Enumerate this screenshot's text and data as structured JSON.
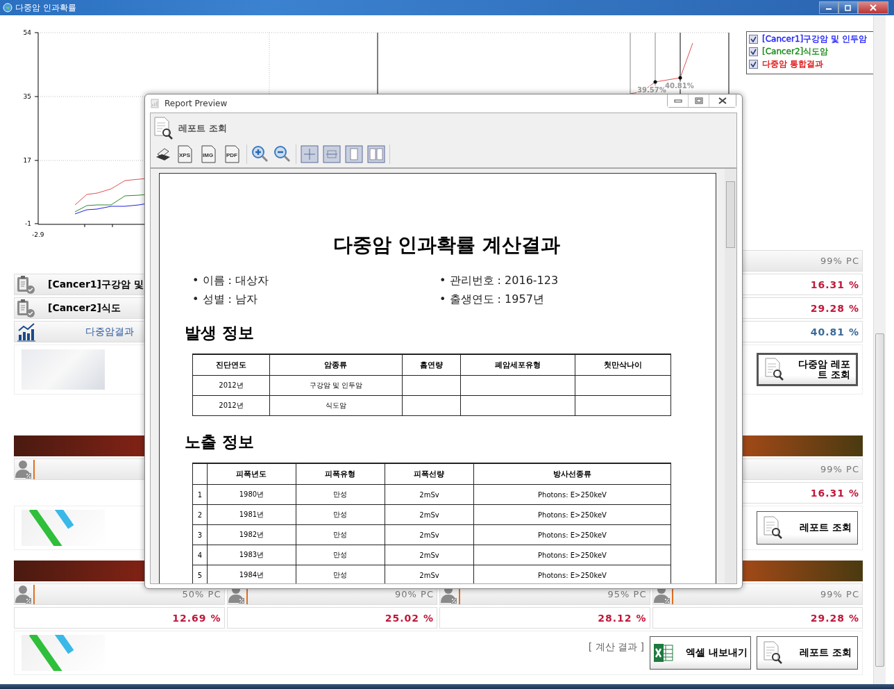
{
  "window": {
    "title": "다중암 인과확률"
  },
  "chart": {
    "y_ticks": [
      "54",
      "35",
      "17",
      "-1"
    ],
    "x_tick": "-2.9",
    "point_labels": [
      "39.57%",
      "40.81%"
    ]
  },
  "legend": [
    {
      "label": "[Cancer1]구강암 및 인두암",
      "checked": true,
      "color": "#1a1aff"
    },
    {
      "label": "[Cancer2]식도암",
      "checked": true,
      "color": "#1a8a1a"
    },
    {
      "label": "다중암 통합결과",
      "checked": true,
      "color": "#e01010"
    }
  ],
  "summary": {
    "header": "99% PC",
    "rows": [
      {
        "kind": "cancer",
        "label": "[Cancer1]구강암 및",
        "value": "16.31 %"
      },
      {
        "kind": "cancer",
        "label": "[Cancer2]식도",
        "value": "29.28 %"
      },
      {
        "kind": "combined",
        "label": "다중암결과",
        "value": "40.81 %"
      }
    ],
    "report_button": "다중암 레포트 조회"
  },
  "section_2": {
    "header": "99% PC",
    "value": "16.31 %",
    "report_button": "레포트 조회"
  },
  "section_3": {
    "columns": [
      {
        "header": "50% PC",
        "value": "12.69 %"
      },
      {
        "header": "90% PC",
        "value": "25.02 %"
      },
      {
        "header": "95% PC",
        "value": "28.12 %"
      },
      {
        "header": "99% PC",
        "value": "29.28 %"
      }
    ],
    "caption": "[ 계산 결과 ]",
    "export_button": "엑셀 내보내기",
    "report_button": "레포트 조회"
  },
  "report_preview": {
    "title": "Report Preview",
    "heading": "레포트 조회",
    "toolbar": [
      {
        "kind": "print"
      },
      {
        "kind": "file",
        "label": "XPS"
      },
      {
        "kind": "file",
        "label": "IMG"
      },
      {
        "kind": "file",
        "label": "PDF"
      },
      {
        "kind": "zoom_in"
      },
      {
        "kind": "zoom_out"
      },
      {
        "kind": "fit_page"
      },
      {
        "kind": "fit_width"
      },
      {
        "kind": "single_page"
      },
      {
        "kind": "two_pages"
      }
    ],
    "document": {
      "title": "다중암 인과확률 계산결과",
      "info": [
        {
          "label": "이름 : 대상자"
        },
        {
          "label": "관리번호 : 2016-123"
        },
        {
          "label": "성별 : 남자"
        },
        {
          "label": "출생연도 : 1957년"
        }
      ],
      "bullet": "•",
      "sections": [
        {
          "title": "발생 정보",
          "columns": [
            "진단연도",
            "암종류",
            "흡연량",
            "폐암세포유형",
            "첫만삭나이"
          ],
          "rows": [
            [
              "2012년",
              "구강암 및 인두암",
              "",
              "",
              ""
            ],
            [
              "2012년",
              "식도암",
              "",
              "",
              ""
            ]
          ]
        },
        {
          "title": "노출 정보",
          "columns": [
            "",
            "피폭년도",
            "피폭유형",
            "피폭선량",
            "방사선종류"
          ],
          "rows": [
            [
              "1",
              "1980년",
              "만성",
              "2mSv",
              "Photons: E>250keV"
            ],
            [
              "2",
              "1981년",
              "만성",
              "2mSv",
              "Photons: E>250keV"
            ],
            [
              "3",
              "1982년",
              "만성",
              "2mSv",
              "Photons: E>250keV"
            ],
            [
              "4",
              "1983년",
              "만성",
              "2mSv",
              "Photons: E>250keV"
            ],
            [
              "5",
              "1984년",
              "만성",
              "2mSv",
              "Photons: E>250keV"
            ]
          ]
        }
      ]
    }
  }
}
